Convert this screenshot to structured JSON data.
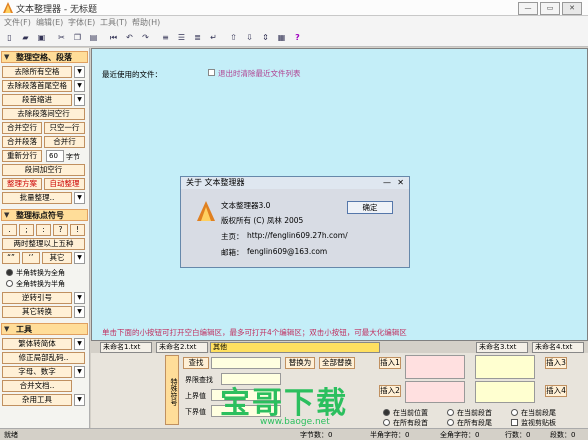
{
  "window": {
    "title": "文本整理器 - 无标题"
  },
  "menu": [
    "文件(F)",
    "编辑(E)",
    "字体(E)",
    "工具(T)",
    "帮助(H)"
  ],
  "toolbar_icons": [
    "new",
    "open",
    "save",
    "copy",
    "paste",
    "find",
    "undo",
    "redo",
    "help"
  ],
  "sidebar": {
    "section1": "整理空格、段落",
    "b_remove_all_spaces": "去除所有空格",
    "b_remove_head_tail": "去除段落首尾空格",
    "b_indent": "段首缩进",
    "b_remove_blank_lines": "去除段落间空行",
    "b_merge_blank": "合并空行",
    "b_keep_one": "只空一行",
    "b_merge_para": "合并段落",
    "b_merge_lines": "合并行",
    "b_reflow": "重新分行",
    "reflow_value": "60",
    "reflow_unit": "字节",
    "b_add_blank": "段间加空行",
    "b_scheme": "整理方案",
    "b_auto": "自动整理",
    "b_batch": "批量整理..",
    "section2": "整理标点符号",
    "punct": [
      ".",
      ";",
      ":",
      "?",
      "!"
    ],
    "b_over_five": "两时整理以上五种",
    "quote1": "“”",
    "quote2": "‘’",
    "b_other": "其它",
    "r_half_full": "半角转换为全角",
    "r_full_half": "全角转换为半角",
    "b_reverse_quote": "逆转引号",
    "b_other_convert": "其它转换",
    "section3": "工具",
    "b_simp_trad": "繁体转简体",
    "b_fix_code": "修正局部乱码..",
    "b_char_num": "字母、数字",
    "b_merge_docs": "合并文档..",
    "b_misc": "杂用工具"
  },
  "main": {
    "recent_label": "最近使用的文件：",
    "clear_label": "退出时清除最近文件列表",
    "hint": "单击下面的小按钮可打开空白编辑区，最多可打开4个编辑区；双击小按钮，可最大化编辑区"
  },
  "tabs": [
    "未命名1.txt",
    "未命名2.txt",
    "其他",
    "未命名3.txt",
    "未命名4.txt"
  ],
  "bottom": {
    "vertical_label": "特殊符号",
    "find": "查找",
    "replace_with": "替换为",
    "replace_all": "全部替换",
    "range_find": "界限查找",
    "upper": "上界值",
    "lower": "下界值",
    "insert1": "插入1",
    "insert2": "插入2",
    "insert3": "插入3",
    "insert4": "插入4",
    "r_cur_pos": "在当前位置",
    "r_cur_para": "在当前段首",
    "r_cur_para_end": "在当前段尾",
    "r_all_para": "在所有段首",
    "r_all_para_end": "在所有段尾",
    "r_monitor": "监视剪贴板"
  },
  "status": {
    "ready": "就绪",
    "bytes": "字节数：0",
    "half": "半角字符：0",
    "full": "全角字符：0",
    "lines": "行数：0",
    "paras": "段数：0"
  },
  "dialog": {
    "title": "关于 文本整理器",
    "app": "文本整理器3.0",
    "copyright": "版权所有 (C) 凤林 2005",
    "home_label": "主页：",
    "home": "http://fenglin609.27h.com/",
    "email_label": "邮箱：",
    "email": "fenglin609@163.com",
    "ok": "确定"
  },
  "watermark": {
    "text": "宝哥下载",
    "url": "www.baoge.net"
  },
  "colors": {
    "main_bg": "#c4eef8",
    "section_bg": "#ffdd99",
    "button_bg": "#fff0d6",
    "watermark": "#2bbf5e"
  }
}
